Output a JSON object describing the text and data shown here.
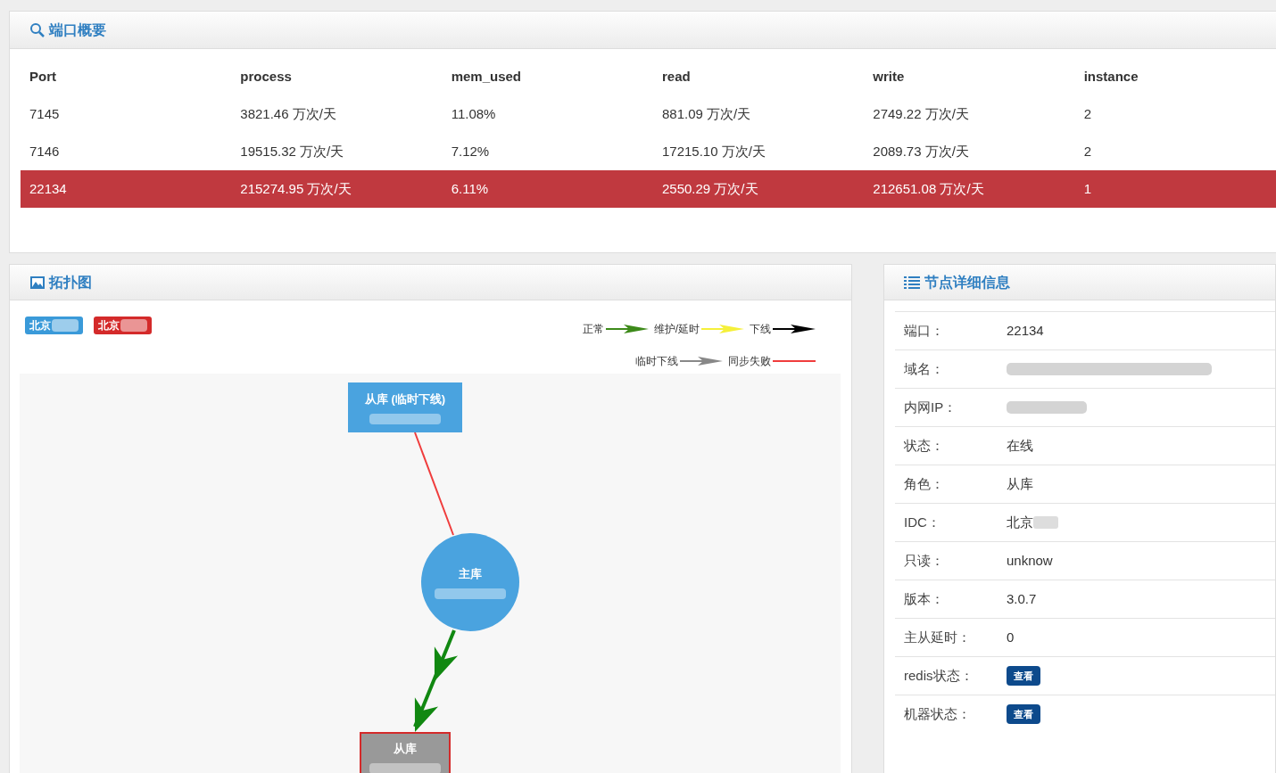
{
  "port_overview": {
    "title": "端口概要",
    "columns": [
      "Port",
      "process",
      "mem_used",
      "read",
      "write",
      "instance"
    ],
    "rows": [
      {
        "cells": [
          "7145",
          "3821.46 万次/天",
          "11.08%",
          "881.09 万次/天",
          "2749.22 万次/天",
          "2"
        ],
        "selected": false
      },
      {
        "cells": [
          "7146",
          "19515.32 万次/天",
          "7.12%",
          "17215.10 万次/天",
          "2089.73 万次/天",
          "2"
        ],
        "selected": false
      },
      {
        "cells": [
          "22134",
          "215274.95 万次/天",
          "6.11%",
          "2550.29 万次/天",
          "212651.08 万次/天",
          "1"
        ],
        "selected": true
      }
    ]
  },
  "topology": {
    "title": "拓扑图",
    "idc_tags": [
      {
        "label": "北京",
        "color": "#3a9ad9",
        "redacted": true
      },
      {
        "label": "北京",
        "color": "#d42a2a",
        "redacted": true
      }
    ],
    "legend": [
      {
        "label": "正常",
        "kind": "arrow",
        "color": "#3d8a1a"
      },
      {
        "label": "维护/延时",
        "kind": "arrow",
        "color": "#f5f03a"
      },
      {
        "label": "下线",
        "kind": "arrow",
        "color": "#000000"
      },
      {
        "label": "临时下线",
        "kind": "arrow",
        "color": "#888888"
      },
      {
        "label": "同步失败",
        "kind": "line",
        "color": "#f03c3c"
      }
    ],
    "nodes": [
      {
        "label": "从库 (临时下线)",
        "kind": "rect",
        "color": "#4aa3df",
        "redacted": true,
        "selected": false
      },
      {
        "label": "主库",
        "kind": "circle",
        "color": "#4aa3df",
        "redacted": true,
        "selected": false
      },
      {
        "label": "从库",
        "kind": "rect",
        "color": "#999999",
        "redacted": true,
        "selected": true
      }
    ],
    "edges": [
      {
        "kind": "line",
        "color": "#f03c3c"
      },
      {
        "kind": "arrow",
        "color": "#118811"
      }
    ]
  },
  "node_details": {
    "title": "节点详细信息",
    "rows": [
      {
        "label": "端口：",
        "kind": "text",
        "value": "22134"
      },
      {
        "label": "域名：",
        "kind": "redacted"
      },
      {
        "label": "内网IP：",
        "kind": "redacted"
      },
      {
        "label": "状态：",
        "kind": "text",
        "value": "在线"
      },
      {
        "label": "角色：",
        "kind": "text",
        "value": "从库"
      },
      {
        "label": "IDC：",
        "kind": "text",
        "value": "北京",
        "redacted": true
      },
      {
        "label": "只读：",
        "kind": "text",
        "value": "unknow"
      },
      {
        "label": "版本：",
        "kind": "text",
        "value": "3.0.7"
      },
      {
        "label": "主从延时：",
        "kind": "text",
        "value": "0"
      },
      {
        "label": "redis状态：",
        "kind": "button",
        "value": "查看"
      },
      {
        "label": "机器状态：",
        "kind": "button",
        "value": "查看"
      }
    ]
  }
}
